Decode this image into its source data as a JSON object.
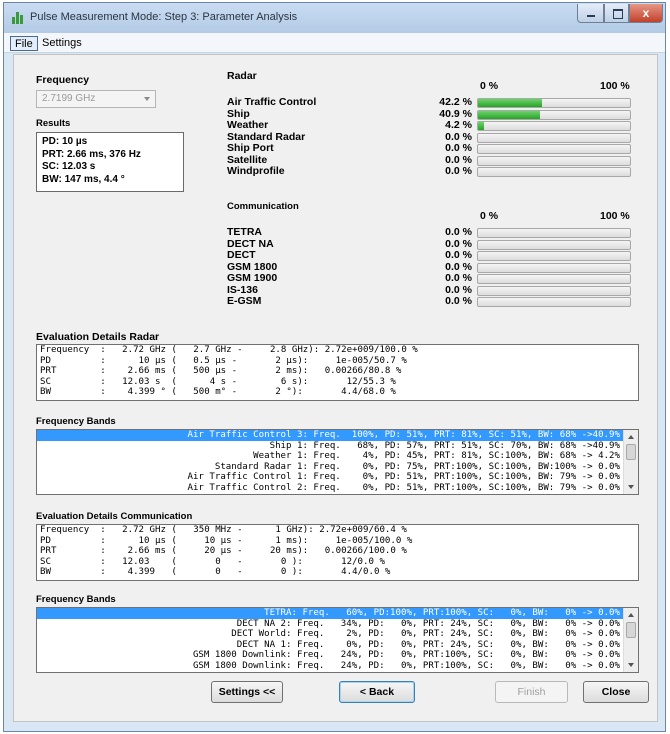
{
  "window": {
    "title": "Pulse Measurement Mode: Step 3: Parameter Analysis",
    "close_glyph": "x"
  },
  "menu": {
    "file": "File",
    "settings": "Settings"
  },
  "frequency": {
    "label": "Frequency",
    "selected": "2.7199 GHz"
  },
  "results": {
    "label": "Results",
    "lines": [
      "PD: 10 µs",
      "PRT: 2.66 ms, 376 Hz",
      "SC: 12.03 s",
      "BW: 147 ms, 4.4 °"
    ]
  },
  "radar": {
    "label": "Radar",
    "scale_min": "0 %",
    "scale_max": "100 %",
    "items": [
      {
        "name": "Air Traffic Control",
        "pct_text": "42.2 %",
        "value": 42.2
      },
      {
        "name": "Ship",
        "pct_text": "40.9 %",
        "value": 40.9
      },
      {
        "name": "Weather",
        "pct_text": "4.2 %",
        "value": 4.2
      },
      {
        "name": "Standard Radar",
        "pct_text": "0.0 %",
        "value": 0
      },
      {
        "name": "Ship Port",
        "pct_text": "0.0 %",
        "value": 0
      },
      {
        "name": "Satellite",
        "pct_text": "0.0 %",
        "value": 0
      },
      {
        "name": "Windprofile",
        "pct_text": "0.0 %",
        "value": 0
      }
    ]
  },
  "communication": {
    "label": "Communication",
    "scale_min": "0 %",
    "scale_max": "100 %",
    "items": [
      {
        "name": "TETRA",
        "pct_text": "0.0 %",
        "value": 0
      },
      {
        "name": "DECT NA",
        "pct_text": "0.0 %",
        "value": 0
      },
      {
        "name": "DECT",
        "pct_text": "0.0 %",
        "value": 0
      },
      {
        "name": "GSM 1800",
        "pct_text": "0.0 %",
        "value": 0
      },
      {
        "name": "GSM 1900",
        "pct_text": "0.0 %",
        "value": 0
      },
      {
        "name": "IS-136",
        "pct_text": "0.0 %",
        "value": 0
      },
      {
        "name": "E-GSM",
        "pct_text": "0.0 %",
        "value": 0
      }
    ]
  },
  "eval_radar": {
    "label": "Evaluation Details Radar",
    "lines": [
      "Frequency  :   2.72 GHz (   2.7 GHz -     2.8 GHz): 2.72e+009/100.0 %",
      "PD         :      10 µs (   0.5 µs -       2 µs):     1e-005/50.7 %",
      "PRT        :    2.66 ms (   500 µs -       2 ms):   0.00266/80.8 %",
      "SC         :   12.03 s  (      4 s -        6 s):       12/55.3 %",
      "BW         :    4.399 ° (   500 m° -       2 °):       4.4/68.0 %"
    ]
  },
  "bands_radar": {
    "label": "Frequency Bands",
    "rows": [
      "Air Traffic Control 3: Freq.  100%, PD: 51%, PRT: 81%, SC: 51%, BW: 68% ->40.9%",
      "Ship 1: Freq.   68%, PD: 57%, PRT: 51%, SC: 70%, BW: 68% ->40.9%",
      "Weather 1: Freq.    4%, PD: 45%, PRT: 81%, SC:100%, BW: 68% -> 4.2%",
      "Standard Radar 1: Freq.    0%, PD: 75%, PRT:100%, SC:100%, BW:100% -> 0.0%",
      "Air Traffic Control 1: Freq.    0%, PD: 51%, PRT:100%, SC:100%, BW: 79% -> 0.0%",
      "Air Traffic Control 2: Freq.    0%, PD: 51%, PRT:100%, SC:100%, BW: 79% -> 0.0%"
    ]
  },
  "eval_comm": {
    "label": "Evaluation Details Communication",
    "lines": [
      "Frequency  :   2.72 GHz (   350 MHz -      1 GHz): 2.72e+009/60.4 %",
      "PD         :      10 µs (     10 µs -      1 ms):     1e-005/100.0 %",
      "PRT        :    2.66 ms (     20 µs -     20 ms):   0.00266/100.0 %",
      "SC         :   12.03    (       0   -       0 ):       12/0.0 %",
      "BW         :    4.399   (       0   -       0 ):       4.4/0.0 %"
    ]
  },
  "bands_comm": {
    "label": "Frequency Bands",
    "rows": [
      "TETRA: Freq.   60%, PD:100%, PRT:100%, SC:   0%, BW:   0% -> 0.0%",
      "DECT NA 2: Freq.   34%, PD:   0%, PRT: 24%, SC:   0%, BW:   0% -> 0.0%",
      "DECT World: Freq.    2%, PD:   0%, PRT: 24%, SC:   0%, BW:   0% -> 0.0%",
      "DECT NA 1: Freq.    0%, PD:   0%, PRT: 24%, SC:   0%, BW:   0% -> 0.0%",
      "GSM 1800 Downlink: Freq.   24%, PD:   0%, PRT:100%, SC:   0%, BW:   0% -> 0.0%",
      "GSM 1800 Downlink: Freq.   24%, PD:   0%, PRT:100%, SC:   0%, BW:   0% -> 0.0%"
    ]
  },
  "buttons": {
    "settings": "Settings <<",
    "back": "< Back",
    "finish": "Finish",
    "close": "Close"
  }
}
